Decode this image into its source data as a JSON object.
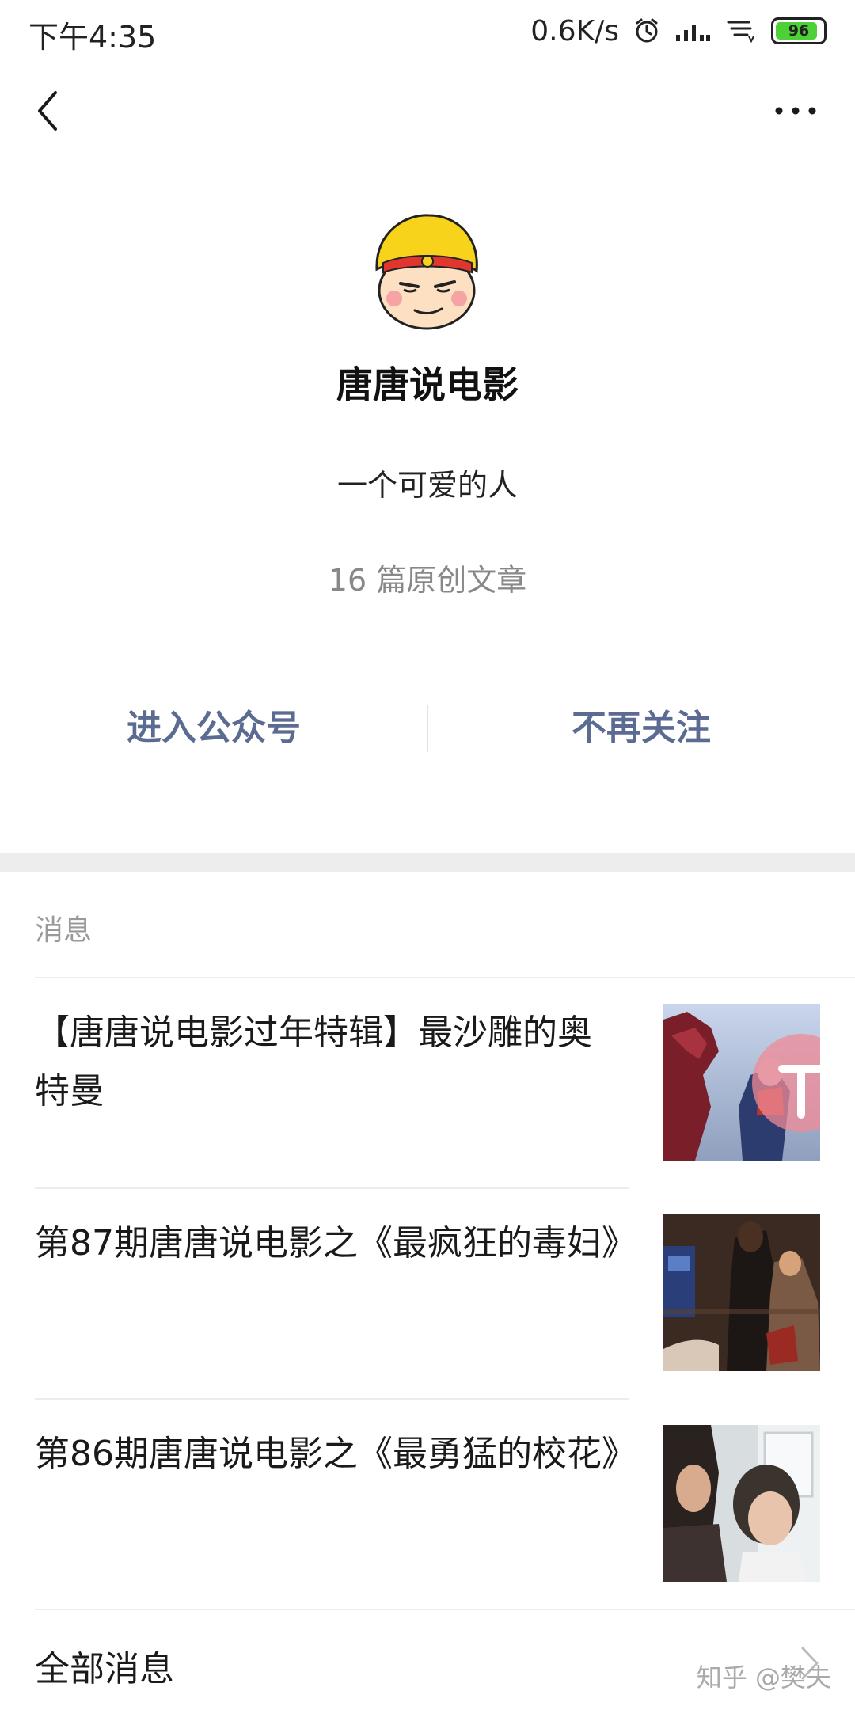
{
  "status": {
    "time": "下午4:35",
    "speed": "0.6K/s",
    "battery": "96"
  },
  "nav": {
    "back_icon": "chevron-left-icon",
    "more_icon": "more-dots-icon"
  },
  "profile": {
    "name": "唐唐说电影",
    "description": "一个可爱的人",
    "stats": "16 篇原创文章"
  },
  "actions": {
    "enter": "进入公众号",
    "unfollow": "不再关注"
  },
  "messages": {
    "title": "消息",
    "items": [
      {
        "title": "【唐唐说电影过年特辑】最沙雕的奥特曼"
      },
      {
        "title": "第87期唐唐说电影之《最疯狂的毒妇》"
      },
      {
        "title": "第86期唐唐说电影之《最勇猛的校花》"
      }
    ],
    "all_label": "全部消息"
  },
  "watermark": "知乎 @樊夫",
  "colors": {
    "link": "#5b6b91",
    "divider_band": "#ededed",
    "muted": "#888888"
  }
}
